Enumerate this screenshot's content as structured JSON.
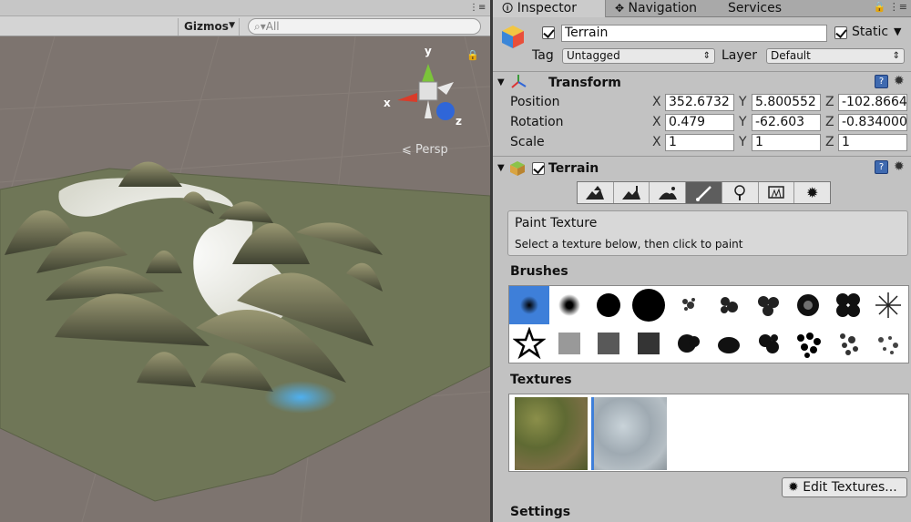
{
  "scene": {
    "gizmos_label": "Gizmos",
    "search_placeholder": "All",
    "persp_label": "Persp",
    "gizmo_axes": {
      "x": "x",
      "y": "y",
      "z": "z"
    }
  },
  "tabs": {
    "inspector": "Inspector",
    "navigation": "Navigation",
    "services": "Services"
  },
  "object": {
    "name": "Terrain",
    "static_label": "Static",
    "tag_label": "Tag",
    "tag_value": "Untagged",
    "layer_label": "Layer",
    "layer_value": "Default"
  },
  "transform": {
    "title": "Transform",
    "position_label": "Position",
    "rotation_label": "Rotation",
    "scale_label": "Scale",
    "position": {
      "x": "352.6732",
      "y": "5.800552",
      "z": "-102.8664"
    },
    "rotation": {
      "x": "0.479",
      "y": "-62.603",
      "z": "-0.834000"
    },
    "scale": {
      "x": "1",
      "y": "1",
      "z": "1"
    }
  },
  "terrain": {
    "title": "Terrain",
    "tools": [
      "raise-lower-icon",
      "paint-height-icon",
      "smooth-height-icon",
      "paint-texture-icon",
      "place-trees-icon",
      "paint-details-icon",
      "settings-icon"
    ],
    "active_tool_index": 3,
    "paint_title": "Paint Texture",
    "paint_hint": "Select a texture below, then click to paint",
    "brushes_label": "Brushes",
    "textures_label": "Textures",
    "edit_textures_label": "Edit Textures...",
    "settings_label": "Settings"
  },
  "colors": {
    "selection_blue": "#3e7fd9",
    "panel_gray": "#c2c2c2",
    "scene_bg": "#7d746f",
    "terrain_green": "#6f7657"
  }
}
